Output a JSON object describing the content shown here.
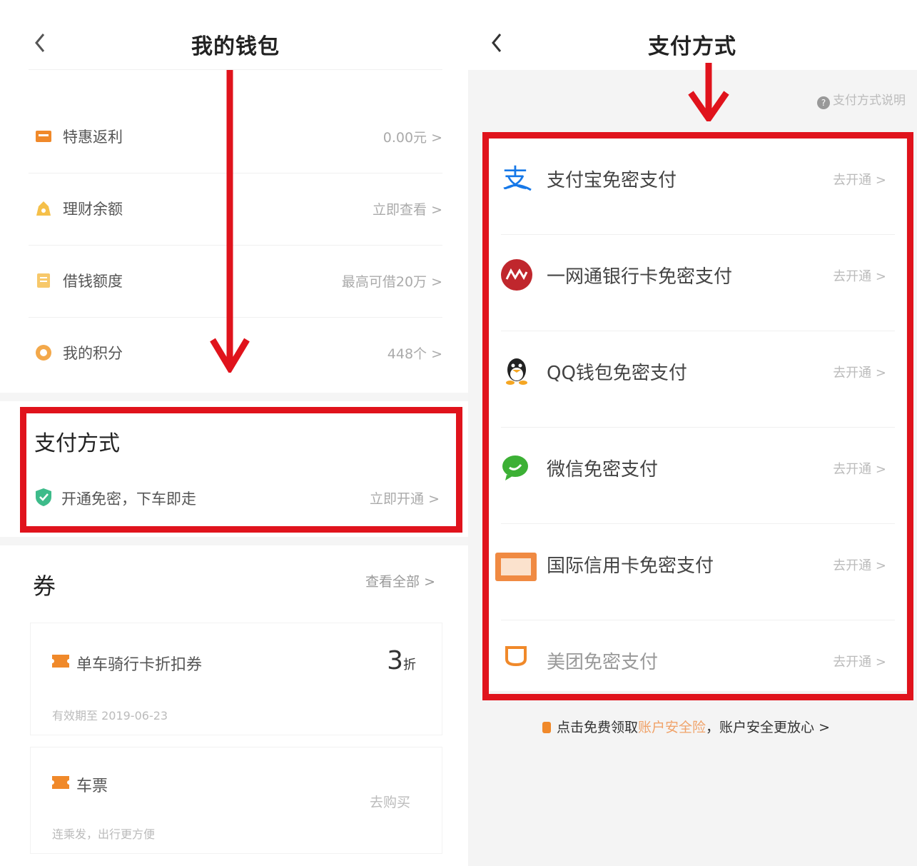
{
  "left": {
    "title": "我的钱包",
    "rows": [
      {
        "label": "特惠返利",
        "value": "0.00元 >",
        "icon": "rebate-icon"
      },
      {
        "label": "理财余额",
        "value": "立即查看 >",
        "icon": "finance-icon"
      },
      {
        "label": "借钱额度",
        "value": "最高可借20万 >",
        "icon": "loan-icon"
      },
      {
        "label": "我的积分",
        "value": "448个 >",
        "icon": "points-icon"
      }
    ],
    "payment": {
      "title": "支付方式",
      "promo_text": "开通免密，下车即走",
      "promo_action": "立即开通 >"
    },
    "coupons": {
      "title": "券",
      "view_all": "查看全部 >",
      "items": [
        {
          "name": "单车骑行卡折扣券",
          "discount_big": "3",
          "discount_small": "折",
          "sub": "有效期至 2019-06-23"
        },
        {
          "name": "车票",
          "action": "去购买",
          "sub": "连乘发，出行更方便"
        }
      ]
    }
  },
  "right": {
    "title": "支付方式",
    "help": "支付方式说明",
    "methods": [
      {
        "label": "支付宝免密支付",
        "action": "去开通 >",
        "icon": "alipay-icon"
      },
      {
        "label": "一网通银行卡免密支付",
        "action": "去开通 >",
        "icon": "cmb-icon"
      },
      {
        "label": "QQ钱包免密支付",
        "action": "去开通 >",
        "icon": "qq-icon"
      },
      {
        "label": "微信免密支付",
        "action": "去开通 >",
        "icon": "wechat-icon"
      },
      {
        "label": "国际信用卡免密支付",
        "action": "去开通 >",
        "icon": "credit-card-icon"
      },
      {
        "label": "美团免密支付",
        "action": "去开通 >",
        "icon": "meituan-icon"
      }
    ],
    "bottom_promo": {
      "prefix": "点击免费领取",
      "link": "账户安全险",
      "suffix": "，账户安全更放心 >"
    }
  },
  "colors": {
    "highlight_red": "#e0131c",
    "accent_orange": "#f0892a"
  }
}
